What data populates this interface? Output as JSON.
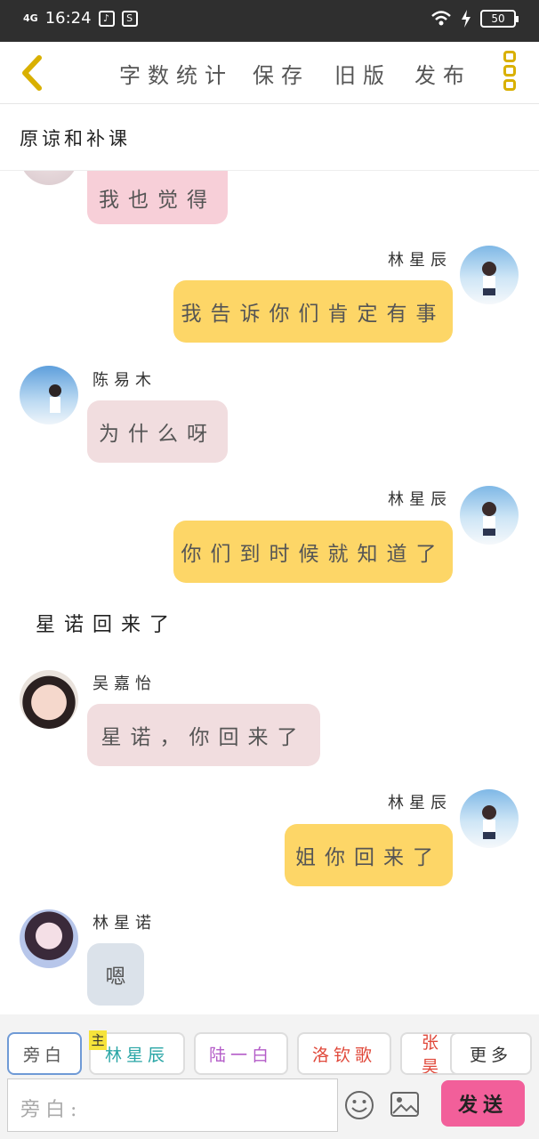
{
  "status": {
    "net": "4G",
    "time": "16:24",
    "battery": "50"
  },
  "toolbar": {
    "items": [
      "字数统计",
      "保存",
      "旧版",
      "发布"
    ]
  },
  "chapter_title": "原谅和补课",
  "messages": [
    {
      "name": "",
      "text": "我也觉得"
    },
    {
      "name": "林星辰",
      "text": "我告诉你们肯定有事"
    },
    {
      "name": "陈易木",
      "text": "为什么呀"
    },
    {
      "name": "林星辰",
      "text": "你们到时候就知道了"
    },
    {
      "narration": "星诺回来了"
    },
    {
      "name": "吴嘉怡",
      "text": "星诺，你回来了"
    },
    {
      "name": "林星辰",
      "text": "姐你回来了"
    },
    {
      "name": "林星诺",
      "text": "嗯"
    }
  ],
  "chips": [
    {
      "label": "旁白",
      "color": "#555555"
    },
    {
      "label": "林星辰",
      "color": "#2aa6a6"
    },
    {
      "label": "陆一白",
      "color": "#b45cc8"
    },
    {
      "label": "洛钦歌",
      "color": "#e0483a"
    },
    {
      "label": "张昊",
      "color": "#e0483a"
    },
    {
      "label": "更多",
      "color": "#333333"
    }
  ],
  "main_badge": "主",
  "input": {
    "placeholder": "旁白:"
  },
  "send_label": "发送",
  "icons": {
    "emoji": "smile-icon",
    "image": "image-icon"
  }
}
